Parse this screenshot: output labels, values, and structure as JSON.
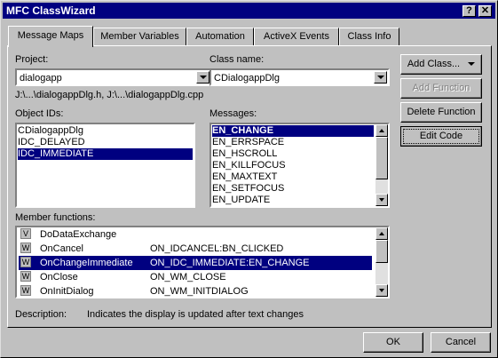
{
  "window": {
    "title": "MFC ClassWizard",
    "help_btn": "?",
    "close_btn": "✕"
  },
  "tabs": [
    "Message Maps",
    "Member Variables",
    "Automation",
    "ActiveX Events",
    "Class Info"
  ],
  "project": {
    "label": "Project:",
    "value": "dialogapp"
  },
  "class_name": {
    "label": "Class name:",
    "value": "CDialogappDlg"
  },
  "files_path": "J:\\...\\dialogappDlg.h, J:\\...\\dialogappDlg.cpp",
  "object_ids": {
    "label": "Object IDs:",
    "items": [
      "CDialogappDlg",
      "IDC_DELAYED",
      "IDC_IMMEDIATE"
    ],
    "selected": 2
  },
  "messages": {
    "label": "Messages:",
    "items": [
      "EN_CHANGE",
      "EN_ERRSPACE",
      "EN_HSCROLL",
      "EN_KILLFOCUS",
      "EN_MAXTEXT",
      "EN_SETFOCUS",
      "EN_UPDATE"
    ],
    "selected": 0
  },
  "buttons": {
    "add_class": "Add Class...",
    "add_function": "Add Function",
    "delete_function": "Delete Function",
    "edit_code": "Edit Code",
    "ok": "OK",
    "cancel": "Cancel"
  },
  "member_functions": {
    "label": "Member functions:",
    "rows": [
      {
        "icon": "V",
        "name": "DoDataExchange",
        "map": ""
      },
      {
        "icon": "W",
        "name": "OnCancel",
        "map": "ON_IDCANCEL:BN_CLICKED"
      },
      {
        "icon": "W",
        "name": "OnChangeImmediate",
        "map": "ON_IDC_IMMEDIATE:EN_CHANGE"
      },
      {
        "icon": "W",
        "name": "OnClose",
        "map": "ON_WM_CLOSE"
      },
      {
        "icon": "W",
        "name": "OnInitDialog",
        "map": "ON_WM_INITDIALOG"
      }
    ],
    "selected": 2
  },
  "description": {
    "label": "Description:",
    "text": "Indicates the display is updated after text changes"
  }
}
